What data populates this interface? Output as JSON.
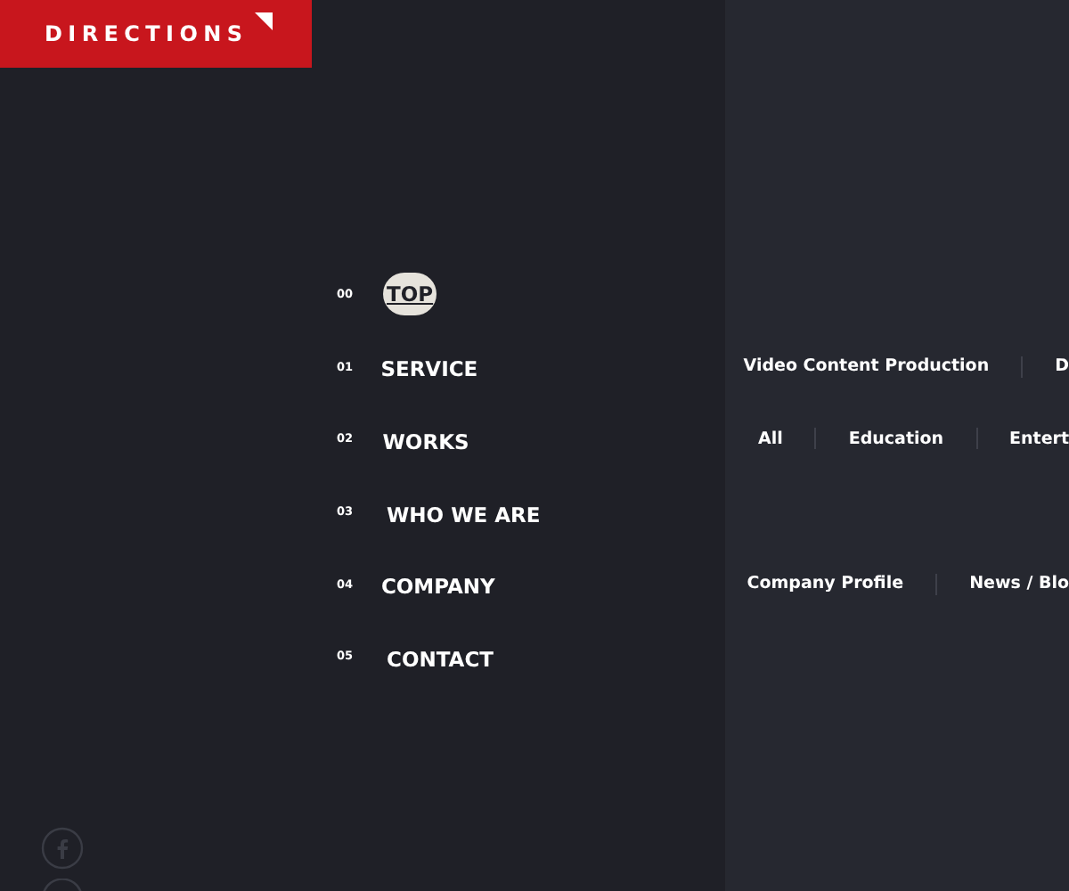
{
  "header": {
    "title": "DIRECTIONS"
  },
  "menu": [
    {
      "number": "00",
      "label": "TOP",
      "selected": true
    },
    {
      "number": "01",
      "label": "SERVICE",
      "selected": false,
      "links": [
        "Video Content Production",
        "D"
      ]
    },
    {
      "number": "02",
      "label": "WORKS",
      "selected": false,
      "links": [
        "All",
        "Education",
        "Entert"
      ]
    },
    {
      "number": "03",
      "label": "WHO WE ARE",
      "selected": false
    },
    {
      "number": "04",
      "label": "COMPANY",
      "selected": false,
      "links": [
        "Company Profile",
        "News / Blo"
      ]
    },
    {
      "number": "05",
      "label": "CONTACT",
      "selected": false
    }
  ]
}
